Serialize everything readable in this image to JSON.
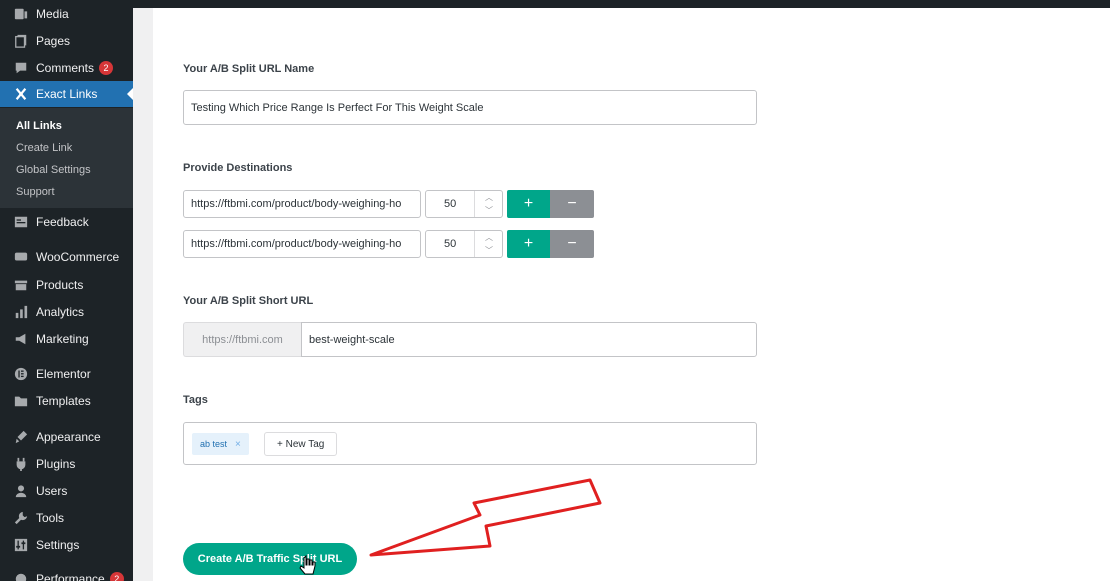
{
  "sidebar": {
    "items": [
      {
        "label": "Media",
        "icon": "media-icon"
      },
      {
        "label": "Pages",
        "icon": "pages-icon"
      },
      {
        "label": "Comments",
        "icon": "comments-icon",
        "badge": "2"
      },
      {
        "label": "Exact Links",
        "icon": "exact-links-icon",
        "active": true
      },
      {
        "label": "Feedback",
        "icon": "feedback-icon"
      },
      {
        "label": "WooCommerce",
        "icon": "woocommerce-icon"
      },
      {
        "label": "Products",
        "icon": "products-icon"
      },
      {
        "label": "Analytics",
        "icon": "analytics-icon"
      },
      {
        "label": "Marketing",
        "icon": "marketing-icon"
      },
      {
        "label": "Elementor",
        "icon": "elementor-icon"
      },
      {
        "label": "Templates",
        "icon": "templates-icon"
      },
      {
        "label": "Appearance",
        "icon": "appearance-icon"
      },
      {
        "label": "Plugins",
        "icon": "plugins-icon"
      },
      {
        "label": "Users",
        "icon": "users-icon"
      },
      {
        "label": "Tools",
        "icon": "tools-icon"
      },
      {
        "label": "Settings",
        "icon": "settings-icon"
      },
      {
        "label": "Performance",
        "icon": "performance-icon",
        "badge": "2"
      }
    ],
    "submenu": [
      {
        "label": "All Links",
        "current": true
      },
      {
        "label": "Create Link"
      },
      {
        "label": "Global Settings"
      },
      {
        "label": "Support"
      }
    ]
  },
  "form": {
    "name_label": "Your A/B Split URL Name",
    "name_value": "Testing Which Price Range Is Perfect For This Weight Scale",
    "destinations_label": "Provide Destinations",
    "destinations": [
      {
        "url": "https://ftbmi.com/product/body-weighing-ho",
        "weight": "50"
      },
      {
        "url": "https://ftbmi.com/product/body-weighing-ho",
        "weight": "50"
      }
    ],
    "plus_label": "+",
    "minus_label": "−",
    "short_url_label": "Your A/B Split Short URL",
    "short_url_prefix": "https://ftbmi.com",
    "short_url_slug": "best-weight-scale",
    "tags_label": "Tags",
    "tags": [
      "ab test"
    ],
    "tag_remove": "×",
    "new_tag_label": "+ New Tag",
    "submit_label": "Create A/B Traffic Split URL"
  },
  "colors": {
    "accent": "#00a68a",
    "wp_blue": "#2271b1",
    "annotation_arrow": "#e02020"
  }
}
